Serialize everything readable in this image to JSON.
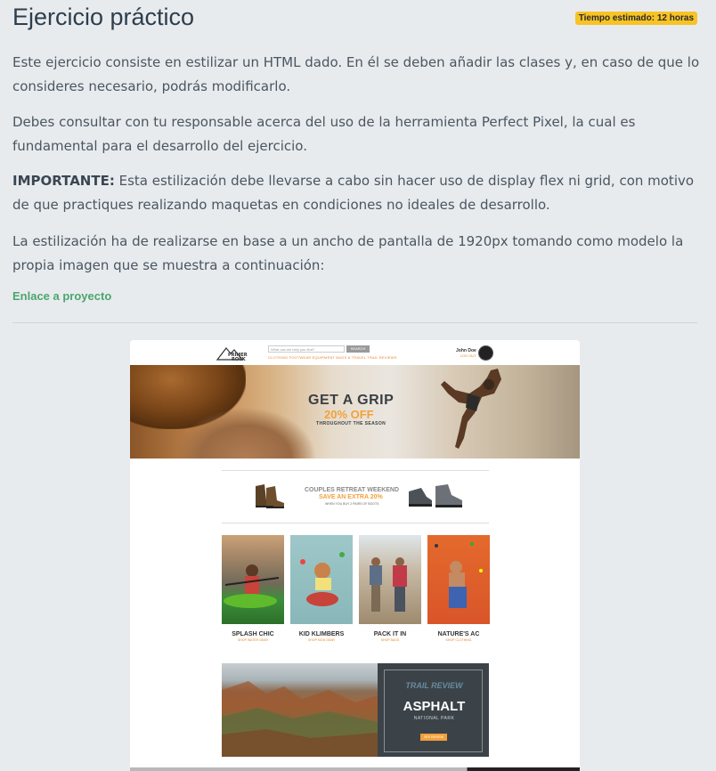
{
  "header": {
    "title": "Ejercicio práctico",
    "badge": "Tiempo estimado: 12 horas"
  },
  "content": {
    "p1": "Este ejercicio consiste en estilizar un HTML dado. En él se deben añadir las clases y, en caso de que lo consideres necesario, podrás modificarlo.",
    "p2": "Debes consultar con tu responsable acerca del uso de la herramienta Perfect Pixel, la cual es fundamental para el desarrollo del ejercicio.",
    "p3_bold": "IMPORTANTE:",
    "p3_rest": " Esta estilización debe llevarse a cabo sin hacer uso de display flex ni grid, con motivo de que practiques realizando maquetas en condiciones no ideales de desarrollo.",
    "p4": "La estilización ha de realizarse en base a un ancho de pantalla de 1920px tomando como modelo la propia imagen que se muestra a continuación:",
    "link": "Enlace a proyecto"
  },
  "mockup": {
    "logo": "PRIMER ROCK",
    "search_placeholder": "What can we help you find?",
    "search_button": "SEARCH",
    "nav": "CLOTHING    FOOTWEAR    EQUIPMENT    BAGS & TRAVEL    TRAIL REVIEWS",
    "user_name": "John Doe",
    "user_link": "LOG OUT",
    "hero_title": "GET A GRIP",
    "hero_offer": "20% OFF",
    "hero_sub": "THROUGHOUT THE SEASON",
    "banner_title": "COUPLES RETREAT WEEKEND",
    "banner_offer": "SAVE AN EXTRA 20%",
    "banner_sub": "WHEN YOU BUY 2 PAIRS OF BOOTS",
    "categories": [
      {
        "label": "SPLASH CHIC",
        "sub": "SHOP WATER GEAR"
      },
      {
        "label": "KID KLIMBERS",
        "sub": "SHOP KIDS GEAR"
      },
      {
        "label": "PACK IT IN",
        "sub": "SHOP BAGS"
      },
      {
        "label": "NATURE'S AC",
        "sub": "SHOP CLOTHING"
      }
    ],
    "trail_title": "TRAIL REVIEW",
    "trail_name": "ASPHALT",
    "trail_park": "NATIONAL PARK",
    "trail_button": "SEE REVIEW"
  },
  "colors": {
    "accent_green": "#4aa66e",
    "badge_yellow": "#f7c325",
    "mock_orange": "#f2a13a"
  }
}
